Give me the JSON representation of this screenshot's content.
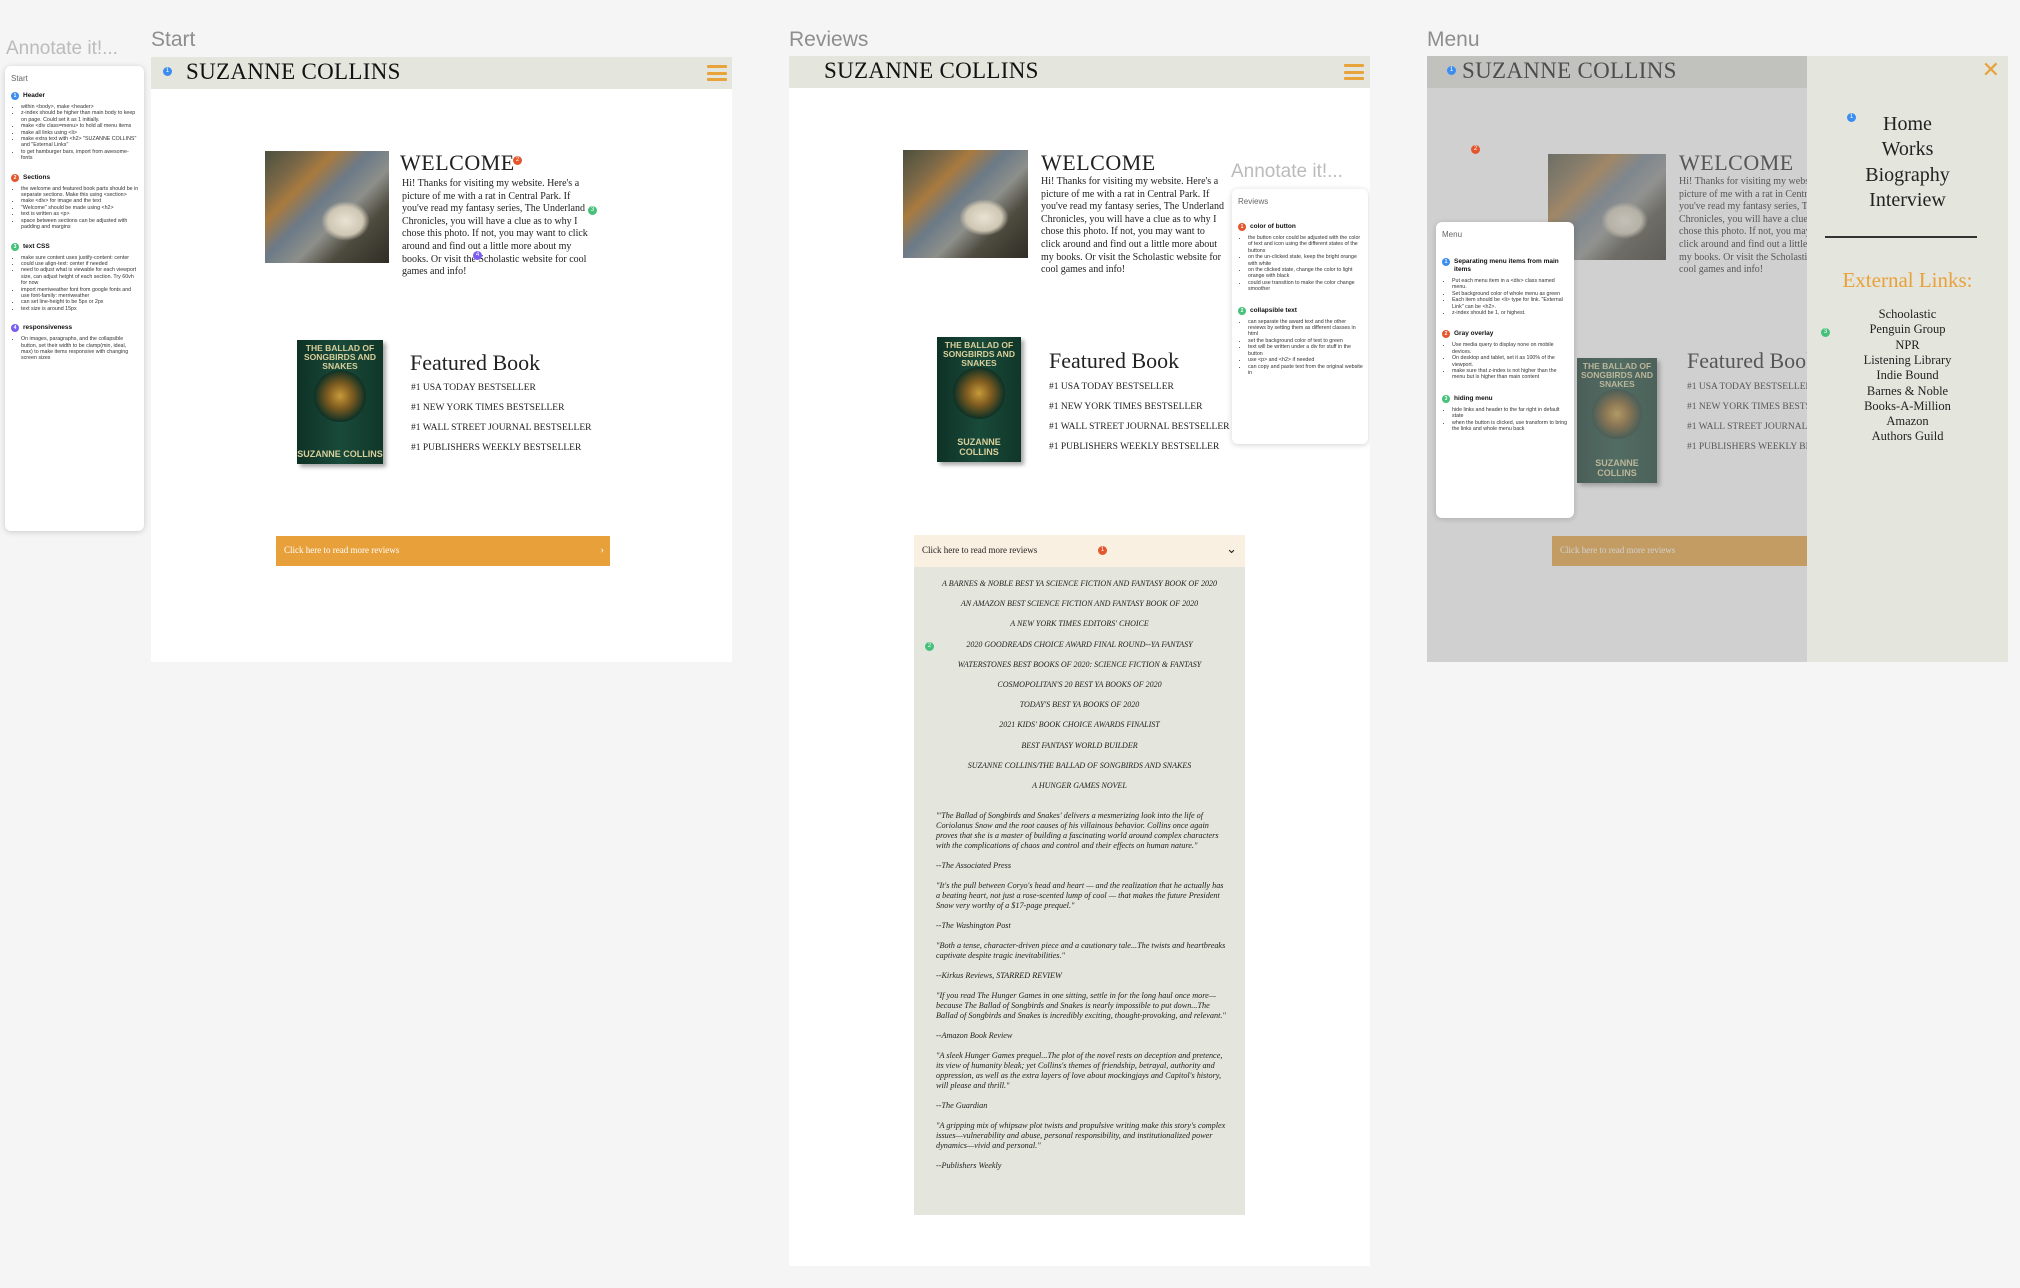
{
  "frames": {
    "start_label": "Start",
    "reviews_label": "Reviews",
    "menu_label": "Menu"
  },
  "site": {
    "title": "SUZANNE COLLINS",
    "welcome_heading": "WELCOME",
    "welcome_text": "Hi! Thanks for visiting my website. Here's a picture of me with a rat in Central Park. If you've read my fantasy series, The Underland Chronicles, you will have a clue as to why I chose this photo. If not, you may want to click around and find out a little more about my books. Or visit the Scholastic website for cool games and info!",
    "featured_heading": "Featured Book",
    "featured_items": [
      "#1 USA TODAY BESTSELLER",
      "#1 NEW YORK TIMES BESTSELLER",
      "#1 WALL STREET JOURNAL BESTSELLER",
      "#1 PUBLISHERS WEEKLY BESTSELLER"
    ],
    "book_title": "THE BALLAD OF SONGBIRDS AND SNAKES",
    "book_author": "SUZANNE COLLINS",
    "cta_label": "Click here to read more reviews",
    "photo_alt": "photo of Suzanne Collins with a rat in Central Park"
  },
  "annotations": {
    "title": "Annotate it!...",
    "start_panel": {
      "title": "Start",
      "sections": [
        {
          "num": "1",
          "color": "#3c8df0",
          "heading": "Header",
          "items": [
            "within <body>, make <header>",
            "z-index should be higher than main body to keep on page. Could set it as 1 initially.",
            "make <div class=menu> to hold all menu items",
            "make all links using <li>",
            "make extra text with <h2> \"SUZANNE COLLINS\" and \"External Links\"",
            "to get hamburger bars, import from awesome-fonts"
          ]
        },
        {
          "num": "2",
          "color": "#e4572e",
          "heading": "Sections",
          "items": [
            "the welcome and featured book parts should be in separate sections. Make this using <section>",
            "make <div> for image and the text",
            "\"Welcome\" should be made using <h2>",
            "text is written as <p>",
            "space between sections can be adjusted with padding and margins"
          ]
        },
        {
          "num": "3",
          "color": "#46c07a",
          "heading": "text CSS",
          "items": [
            "make sure content uses justify-content: center",
            "could use align-text: center if needed",
            "need to adjust what is viewable for each viewport size, can adjust height of each section. Try 60vh for now",
            "import merriweather font from google fonts and use font-family: merriweather",
            "can set line-height to be 5px or 2px",
            "text size is around 15px"
          ]
        },
        {
          "num": "4",
          "color": "#7b5cf0",
          "heading": "responsiveness",
          "items": [
            "On images, paragraphs, and the collapsible button, set their width to be clamp(min, ideal, max) to make items responsive with changing screen sizes"
          ]
        }
      ]
    },
    "reviews_panel": {
      "title": "Reviews",
      "sections": [
        {
          "num": "1",
          "color": "#e4572e",
          "heading": "color of button",
          "items": [
            "the button color could be adjusted with the color of text and icon using the different states of the buttons",
            "on the un-clicked state, keep the bright orange with white",
            "on the clicked state, change the color to light orange with black",
            "could use transition to make the color change smoother"
          ]
        },
        {
          "num": "2",
          "color": "#46c07a",
          "heading": "collapsible text",
          "items": [
            "can separate the award text and the other reviews by setting them as different classes in html",
            "set the background color of text to green",
            "text will be written under a div for stuff in the button",
            "use <p> and <h2> if needed",
            "can copy and paste text from the original website in"
          ]
        }
      ]
    },
    "menu_panel": {
      "title": "Menu",
      "sections": [
        {
          "num": "1",
          "color": "#3c8df0",
          "heading": "Separating menu items from main items",
          "items": [
            "Put each menu item in a <div> class named menu.",
            "Set background color of whole menu as green",
            "Each item should be <li> type for link. \"External Link\" can be <h2>.",
            "z-index should be 1, or highest."
          ]
        },
        {
          "num": "2",
          "color": "#e4572e",
          "heading": "Gray overlay",
          "items": [
            "Use media query to display none on mobile devices.",
            "On desktop and tablet, set it as 100% of the viewport.",
            "make sure that z-index is not higher than the menu but is higher than main content"
          ]
        },
        {
          "num": "3",
          "color": "#46c07a",
          "heading": "hiding menu",
          "items": [
            "hide links and header to the far right in default state",
            "when the button is clicked, use transform to bring the links and whole menu back"
          ]
        }
      ]
    }
  },
  "reviews": {
    "button_label": "Click here to read more reviews",
    "awards": [
      "A BARNES & NOBLE BEST YA SCIENCE FICTION AND FANTASY BOOK OF 2020",
      "AN AMAZON BEST SCIENCE FICTION AND FANTASY BOOK OF 2020",
      "A NEW YORK TIMES EDITORS' CHOICE",
      "2020 GOODREADS CHOICE AWARD FINAL ROUND--YA FANTASY",
      "WATERSTONES BEST BOOKS OF 2020: SCIENCE FICTION & FANTASY",
      "COSMOPOLITAN'S 20 BEST YA BOOKS OF 2020",
      "TODAY'S BEST YA BOOKS OF 2020",
      "2021 KIDS' BOOK CHOICE AWARDS FINALIST",
      "BEST FANTASY WORLD BUILDER",
      "SUZANNE COLLINS/THE BALLAD OF SONGBIRDS AND SNAKES",
      "A HUNGER GAMES NOVEL"
    ],
    "quotes": [
      "\"'The Ballad of Songbirds and Snakes' delivers a mesmerizing look into the life of Coriolanus Snow and the root causes of his villainous behavior. Collins once again proves that she is a master of building a fascinating world around complex characters with the complications of chaos and control and their effects on human nature.\"",
      "--The Associated Press",
      "\"It's the pull between Coryo's head and heart — and the realization that he actually has a beating heart, not just a rose-scented lump of cool — that makes the future President Snow very worthy of a $17-page prequel.\"",
      "--The Washington Post",
      "\"Both a tense, character-driven piece and a cautionary tale...The twists and heartbreaks captivate despite tragic inevitabilities.\"",
      "--Kirkus Reviews, STARRED REVIEW",
      "\"If you read The Hunger Games in one sitting, settle in for the long haul once more—because The Ballad of Songbirds and Snakes is nearly impossible to put down...The Ballad of Songbirds and Snakes is incredibly exciting, thought-provoking, and relevant.\"",
      "--Amazon Book Review",
      "\"A sleek Hunger Games prequel...The plot of the novel rests on deception and pretence, its view of humanity bleak; yet Collins's themes of friendship, betrayal, authority and oppression, as well as the extra layers of love about mockingjays and Capitol's history, will please and thrill.\"",
      "--The Guardian",
      "\"A gripping mix of whipsaw plot twists and propulsive writing make this story's complex issues—vulnerability and abuse, personal responsibility, and institutionalized power dynamics—vivid and personal.\"",
      "--Publishers Weekly"
    ]
  },
  "menu": {
    "nav": [
      "Home",
      "Works",
      "Biography",
      "Interview"
    ],
    "external_heading": "External Links:",
    "external_links": [
      "Schoolastic",
      "Penguin Group",
      "NPR",
      "Listening Library",
      "Indie Bound",
      "Barnes & Noble",
      "Books-A-Million",
      "Amazon",
      "Authors Guild"
    ],
    "close_icon": "close-icon"
  },
  "colors": {
    "accent": "#e8a13a",
    "header_bg": "#e4e5dc",
    "reviews_button_bg": "#faf0e2"
  }
}
